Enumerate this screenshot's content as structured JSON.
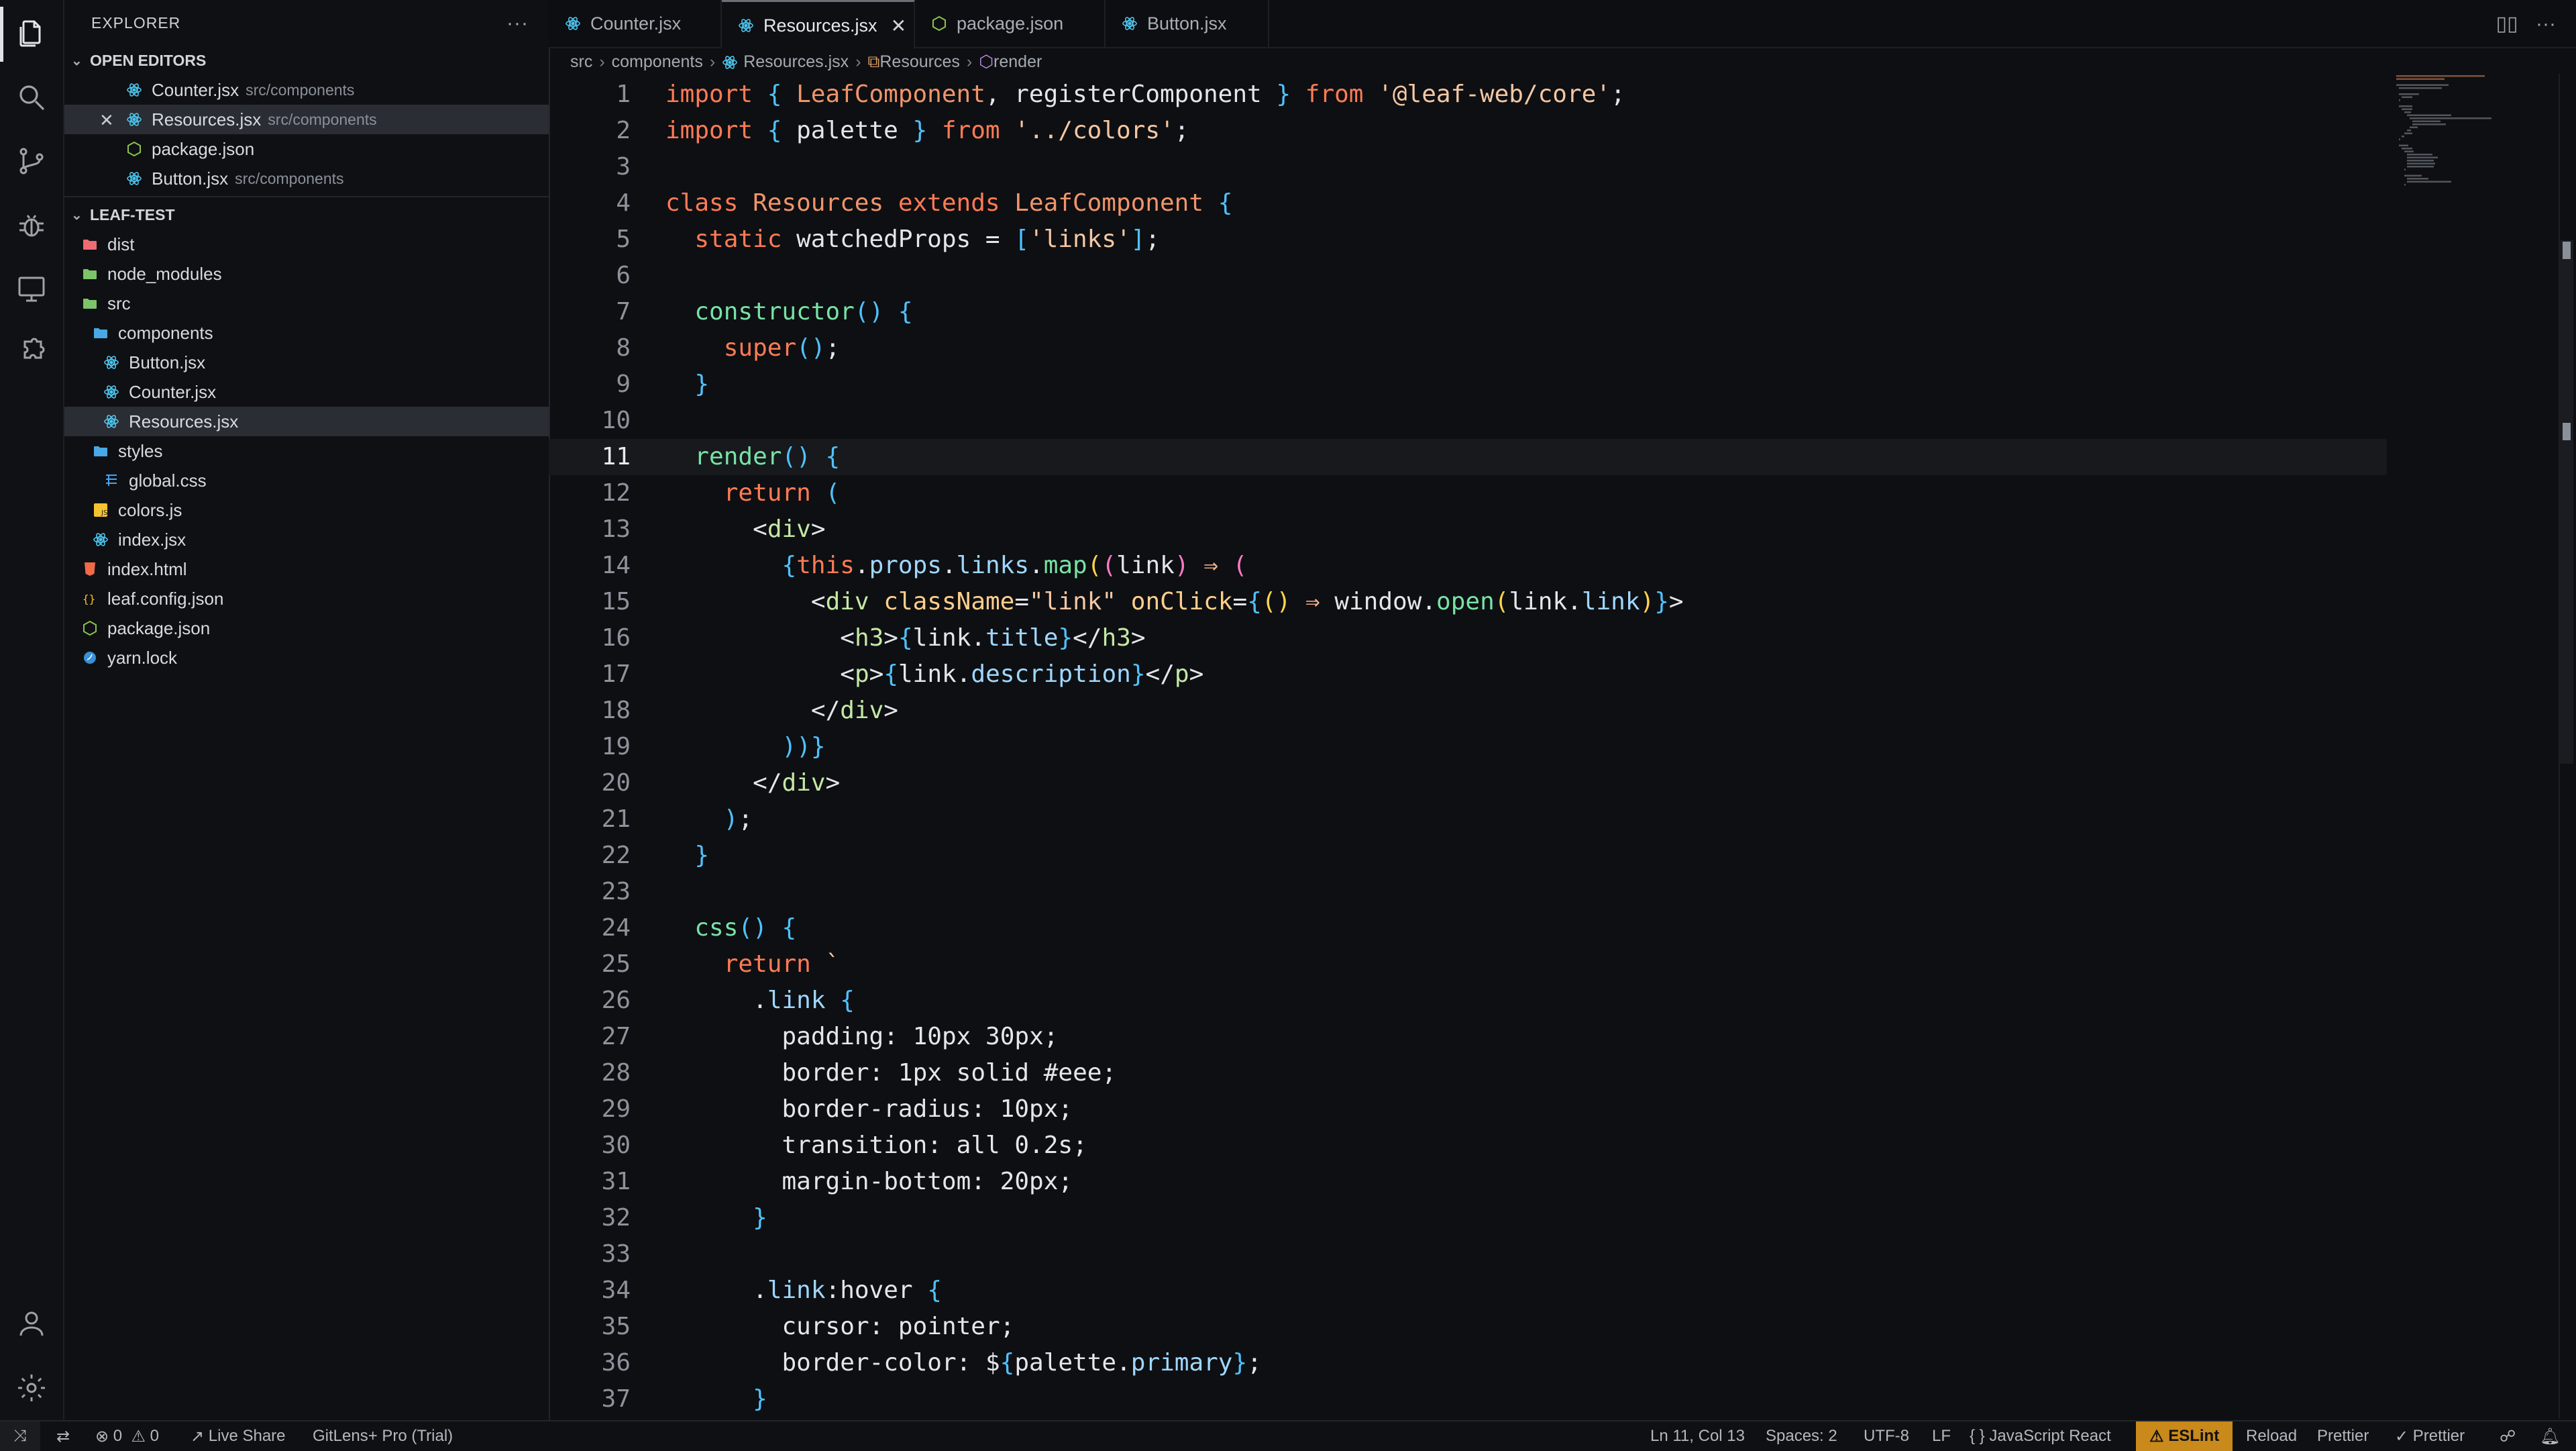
{
  "sidebar": {
    "title": "EXPLORER",
    "open_editors_title": "OPEN EDITORS",
    "open_editors": [
      {
        "name": "Counter.jsx",
        "hint": "src/components",
        "icon": "react-icon",
        "selected": false
      },
      {
        "name": "Resources.jsx",
        "hint": "src/components",
        "icon": "react-icon",
        "selected": true
      },
      {
        "name": "package.json",
        "hint": "",
        "icon": "node-icon",
        "selected": false
      },
      {
        "name": "Button.jsx",
        "hint": "src/components",
        "icon": "react-icon",
        "selected": false
      }
    ],
    "project_title": "LEAF-TEST",
    "tree": [
      {
        "name": "dist",
        "icon": "folder-red-icon",
        "depth": 0
      },
      {
        "name": "node_modules",
        "icon": "folder-green-icon",
        "depth": 0
      },
      {
        "name": "src",
        "icon": "folder-green-icon",
        "depth": 0
      },
      {
        "name": "components",
        "icon": "folder-blue-icon",
        "depth": 1
      },
      {
        "name": "Button.jsx",
        "icon": "react-icon",
        "depth": 2
      },
      {
        "name": "Counter.jsx",
        "icon": "react-icon",
        "depth": 2
      },
      {
        "name": "Resources.jsx",
        "icon": "react-icon",
        "depth": 2,
        "selected": true
      },
      {
        "name": "styles",
        "icon": "folder-blue-icon",
        "depth": 1
      },
      {
        "name": "global.css",
        "icon": "css-icon",
        "depth": 2
      },
      {
        "name": "colors.js",
        "icon": "js-icon",
        "depth": 1
      },
      {
        "name": "index.jsx",
        "icon": "react-icon",
        "depth": 1
      },
      {
        "name": "index.html",
        "icon": "html-icon",
        "depth": 0
      },
      {
        "name": "leaf.config.json",
        "icon": "json-icon",
        "depth": 0
      },
      {
        "name": "package.json",
        "icon": "node-icon",
        "depth": 0
      },
      {
        "name": "yarn.lock",
        "icon": "yarn-icon",
        "depth": 0
      }
    ]
  },
  "tabs": [
    {
      "label": "Counter.jsx",
      "icon": "react-icon",
      "active": false
    },
    {
      "label": "Resources.jsx",
      "icon": "react-icon",
      "active": true
    },
    {
      "label": "package.json",
      "icon": "node-icon",
      "active": false
    },
    {
      "label": "Button.jsx",
      "icon": "react-icon",
      "active": false
    }
  ],
  "breadcrumbs": [
    "src",
    "components",
    "Resources.jsx",
    "Resources",
    "render"
  ],
  "editor": {
    "current_line": 11,
    "lines": [
      "import { LeafComponent, registerComponent } from '@leaf-web/core';",
      "import { palette } from '../colors';",
      "",
      "class Resources extends LeafComponent {",
      "  static watchedProps = ['links'];",
      "",
      "  constructor() {",
      "    super();",
      "  }",
      "",
      "  render() {",
      "    return (",
      "      <div>",
      "        {this.props.links.map((link) => (",
      "          <div className=\"link\" onClick={() => window.open(link.link)}>",
      "            <h3>{link.title}</h3>",
      "            <p>{link.description}</p>",
      "          </div>",
      "        ))}",
      "      </div>",
      "    );",
      "  }",
      "",
      "  css() {",
      "    return `",
      "      .link {",
      "        padding: 10px 30px;",
      "        border: 1px solid #eee;",
      "        border-radius: 10px;",
      "        transition: all 0.2s;",
      "        margin-bottom: 20px;",
      "      }",
      "",
      "      .link:hover {",
      "        cursor: pointer;",
      "        border-color: ${palette.primary};",
      "      }"
    ]
  },
  "statusbar": {
    "errors": "0",
    "warnings": "0",
    "live_share": "Live Share",
    "gitlens": "GitLens+ Pro (Trial)",
    "position": "Ln 11, Col 13",
    "spaces": "Spaces: 2",
    "encoding": "UTF-8",
    "eol": "LF",
    "language": "JavaScript React",
    "eslint": "ESLint",
    "reload": "Reload",
    "prettier1": "Prettier",
    "prettier2": "Prettier"
  },
  "colors": {
    "background": "#0e0f12",
    "keyword": "#ff7b55",
    "function": "#76e3a6",
    "string": "#f4c7a4",
    "eslint_badge": "#c98a1b"
  }
}
